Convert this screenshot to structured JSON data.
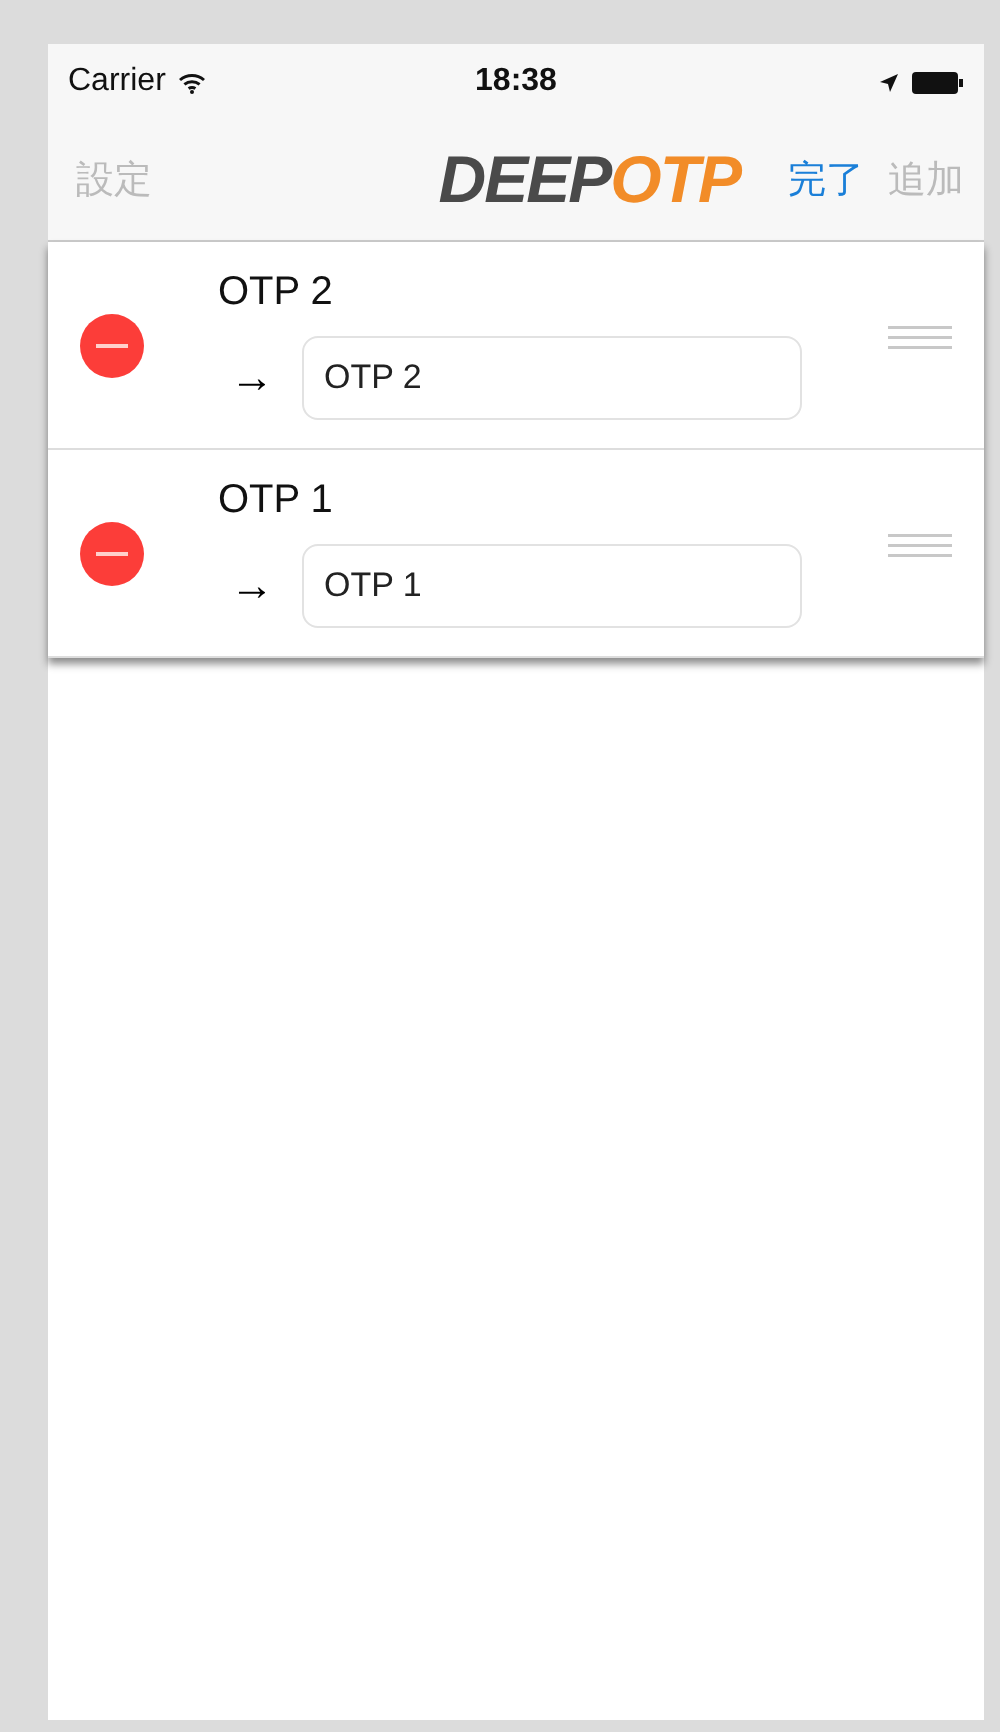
{
  "status_bar": {
    "carrier": "Carrier",
    "time": "18:38"
  },
  "nav_bar": {
    "left_button": {
      "label": "設定",
      "disabled": true
    },
    "logo": {
      "primary": "DEEP",
      "accent": "OTP"
    },
    "right_buttons": [
      {
        "label": "完了",
        "disabled": false
      },
      {
        "label": "追加",
        "disabled": true
      }
    ]
  },
  "rows": [
    {
      "title": "OTP 2",
      "arrow": "→",
      "value": "OTP 2"
    },
    {
      "title": "OTP 1",
      "arrow": "→",
      "value": "OTP 1"
    }
  ]
}
